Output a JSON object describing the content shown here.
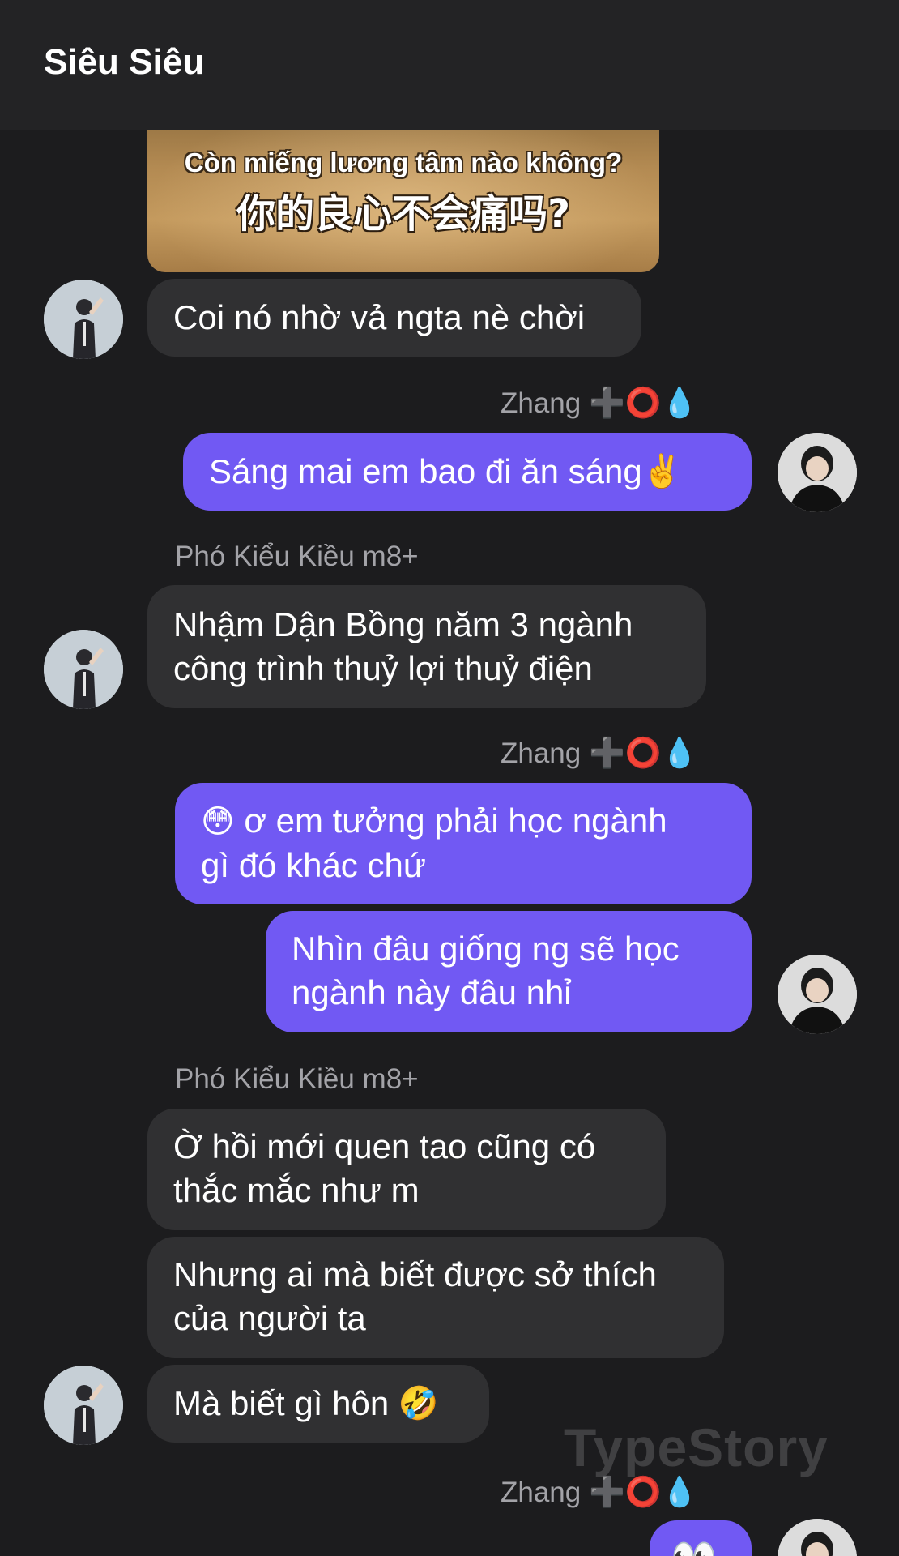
{
  "header": {
    "title": "Siêu Siêu"
  },
  "image_message": {
    "line_vi": "Còn miếng lương tâm nào không?",
    "line_zh": "你的良心不会痛吗?"
  },
  "messages": [
    {
      "direction": "incoming",
      "text": "Coi nó nhờ vả ngta nè chời"
    },
    {
      "direction": "outgoing",
      "sender": "Zhang",
      "sender_emoji": "➕⭕💧",
      "text": "Sáng mai em bao đi ăn sáng",
      "emoji": "✌️"
    },
    {
      "direction": "incoming",
      "sender": "Phó Kiểu Kiều m8+",
      "lines": [
        "Nhậm Dận Bồng năm 3 ngành",
        "công trình thuỷ lợi thuỷ điện"
      ]
    },
    {
      "direction": "outgoing",
      "sender": "Zhang",
      "sender_emoji": "➕⭕💧",
      "emoji": "😳",
      "lines": [
        "ơ em tưởng phải học ngành",
        "gì đó khác chứ"
      ]
    },
    {
      "direction": "outgoing",
      "lines": [
        "Nhìn đâu giống ng sẽ học",
        "ngành này đâu nhỉ"
      ]
    },
    {
      "direction": "incoming",
      "sender": "Phó Kiểu Kiều m8+",
      "lines": [
        "Ờ hồi mới quen tao cũng có",
        "thắc mắc như m"
      ]
    },
    {
      "direction": "incoming",
      "lines": [
        "Nhưng ai mà biết được sở thích",
        "của người ta"
      ]
    },
    {
      "direction": "incoming",
      "text": "Mà biết gì hôn",
      "emoji": "🤣"
    },
    {
      "direction": "outgoing",
      "sender": "Zhang",
      "sender_emoji": "➕⭕💧",
      "emoji": "👀"
    }
  ],
  "watermark": "TypeStory",
  "avatars": {
    "incoming": "person-avatar-icon",
    "outgoing": "person-avatar-icon"
  }
}
